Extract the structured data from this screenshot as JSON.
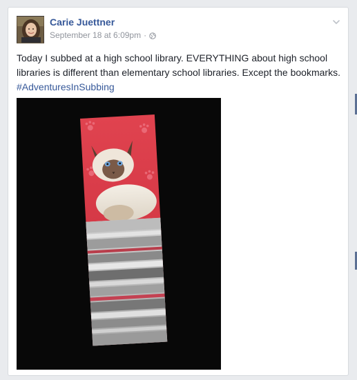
{
  "post": {
    "author_name": "Carie Juettner",
    "timestamp": "September 18 at 6:09pm",
    "separator": "·",
    "privacy_icon": "globe-icon",
    "options_icon": "chevron-down-icon",
    "text_line_1": "Today I subbed at a high school library. EVERYTHING about high school",
    "text_line_2": "libraries is different than elementary school libraries. Except the bookmarks.",
    "hashtag": "#AdventuresInSubbing",
    "link_color": "#365899",
    "text_color": "#1d2129",
    "meta_color": "#90949c"
  }
}
